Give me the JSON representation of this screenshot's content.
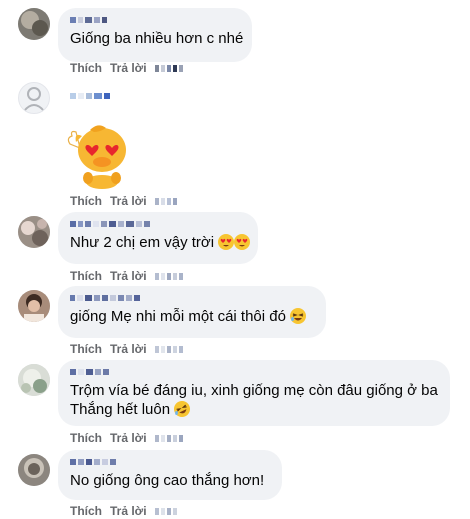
{
  "comments": [
    {
      "text": "Giống ba nhiều hơn c nhé"
    },
    {
      "text": ""
    },
    {
      "text": "Như 2 chị em vậy trời"
    },
    {
      "text": "giống Mẹ nhi mỗi một cái thôi đó"
    },
    {
      "text": "Trộm vía bé đáng iu, xinh giống mẹ còn đâu giống ở ba",
      "text2": "Thắng hết luôn"
    },
    {
      "text": "No giống ông cao thắng hơn!"
    }
  ],
  "actions": {
    "like_label": "Thích",
    "reply_label": "Trả lời"
  },
  "icons": [
    "heart-eyes-emoji-icon",
    "laughing-emoji-icon",
    "rolling-laughing-emoji-icon"
  ],
  "colors": {
    "bubble": "#f0f2f5",
    "action_text": "#65676b",
    "text": "#050505"
  }
}
